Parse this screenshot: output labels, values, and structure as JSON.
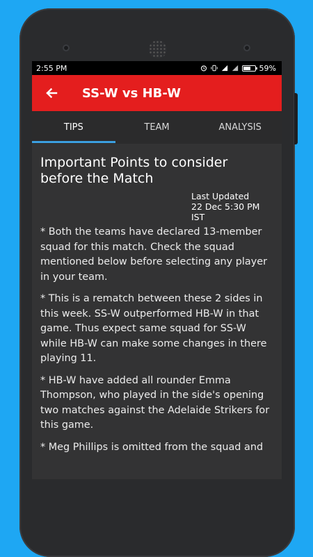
{
  "status_bar": {
    "time": "2:55 PM",
    "battery_percent": "59%"
  },
  "app_bar": {
    "title": "SS-W vs HB-W",
    "back_icon": "arrow-left-icon"
  },
  "tabs": [
    {
      "label": "TIPS",
      "active": true
    },
    {
      "label": "TEAM",
      "active": false
    },
    {
      "label": "ANALYSIS",
      "active": false
    }
  ],
  "content": {
    "heading": "Important Points to consider before the Match",
    "updated_label": "Last Updated",
    "updated_value": "22 Dec 5:30 PM IST",
    "paragraphs": [
      "* Both the teams have declared 13-member squad for this match. Check the squad mentioned below before selecting any player in your team.",
      "* This is a rematch between these 2 sides in this week. SS-W outperformed HB-W in that game. Thus expect same squad for SS-W while HB-W can make some changes in there playing 11.",
      "* HB-W have added all rounder Emma Thompson, who played in the side's opening two matches against the Adelaide Strikers for this game.",
      "* Meg Phillips is omitted from the squad and"
    ]
  },
  "colors": {
    "app_bar": "#e41e1e",
    "background": "#1ea7f3",
    "tab_indicator": "#3b9fe0",
    "content_bg": "#333334"
  }
}
